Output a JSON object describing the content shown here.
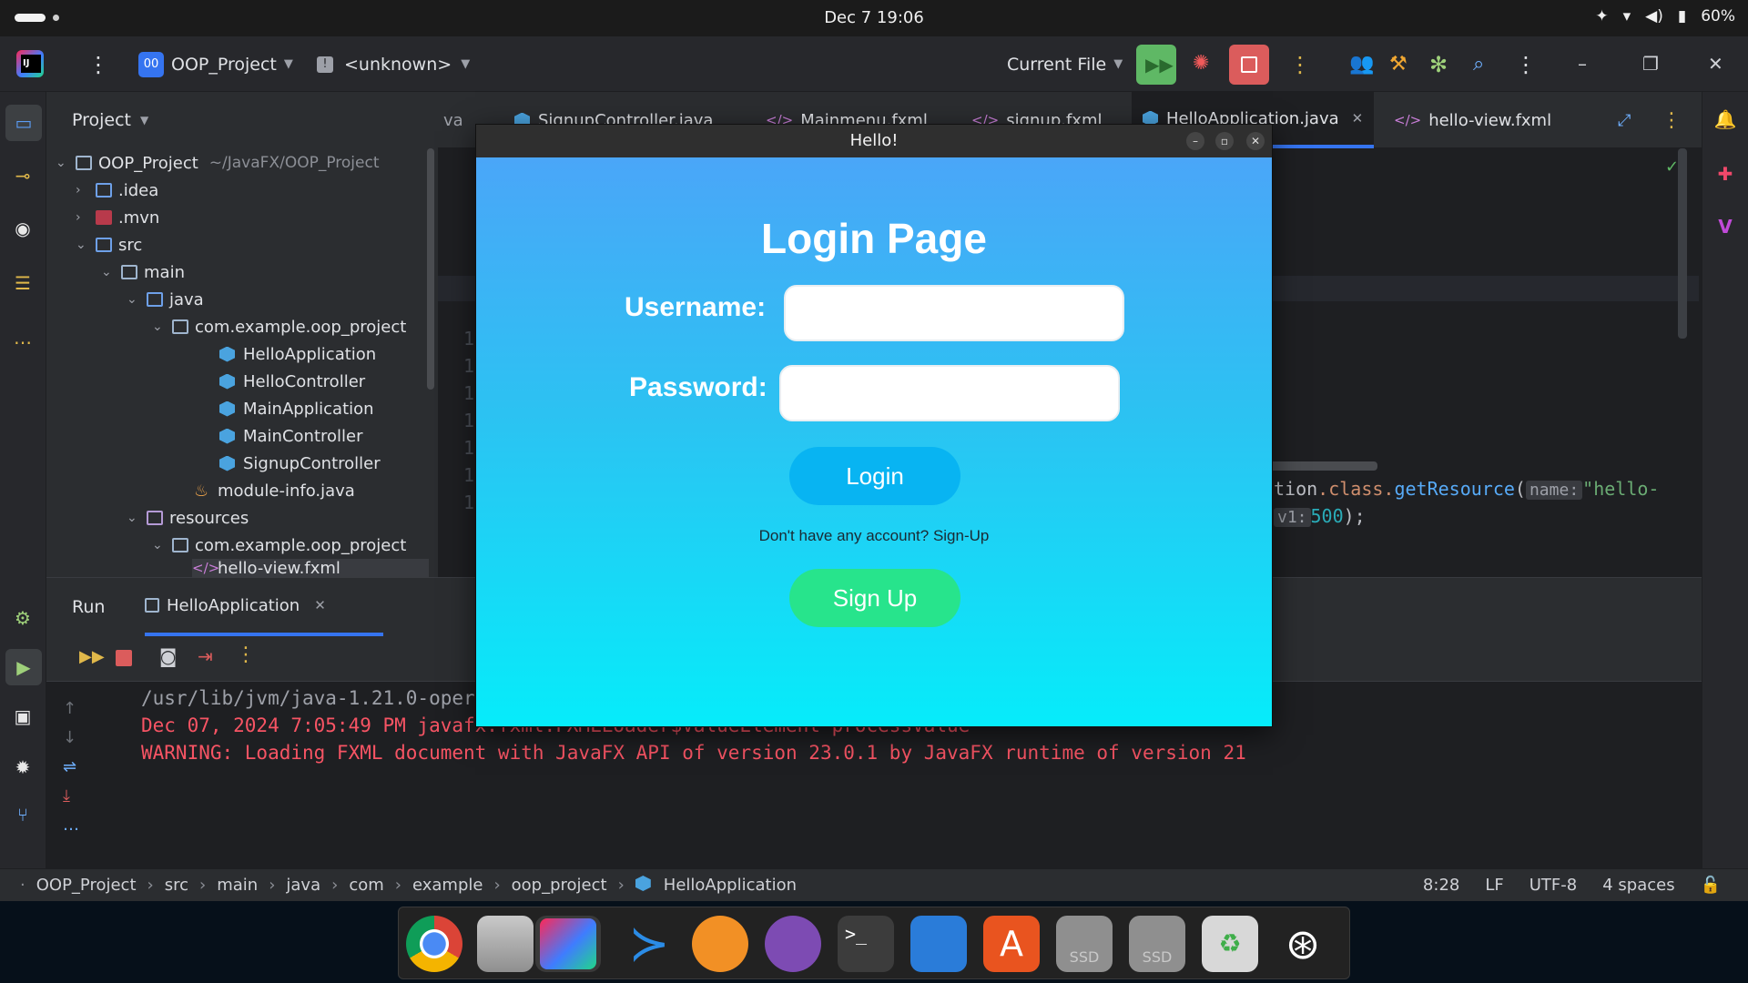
{
  "system_bar": {
    "datetime": "Dec 7  19:06",
    "battery": "60%"
  },
  "toolbar": {
    "project_badge": "00",
    "project_name": "OOP_Project",
    "branch": "<unknown>",
    "run_config": "Current File"
  },
  "project_panel": {
    "title": "Project",
    "tree": [
      {
        "label": "OOP_Project",
        "note": "~/JavaFX/OOP_Project"
      },
      {
        "label": ".idea"
      },
      {
        "label": ".mvn"
      },
      {
        "label": "src"
      },
      {
        "label": "main"
      },
      {
        "label": "java"
      },
      {
        "label": "com.example.oop_project"
      },
      {
        "label": "HelloApplication"
      },
      {
        "label": "HelloController"
      },
      {
        "label": "MainApplication"
      },
      {
        "label": "MainController"
      },
      {
        "label": "SignupController"
      },
      {
        "label": "module-info.java"
      },
      {
        "label": "resources"
      },
      {
        "label": "com.example.oop_project"
      },
      {
        "label": "hello-view.fxml"
      }
    ]
  },
  "editor": {
    "tabs": [
      {
        "label": "va"
      },
      {
        "label": "SignupController.java"
      },
      {
        "label": "Mainmenu.fxml"
      },
      {
        "label": "signup.fxml"
      },
      {
        "label": "HelloApplication.java"
      },
      {
        "label": "hello-view.fxml"
      }
    ],
    "code_line1": {
      "a": "tion",
      "b": ".class.",
      "c": "getResource",
      "d": "name:",
      "e": "\"hello-"
    },
    "code_line2": {
      "hint": "v1:",
      "value": "500",
      "tail": ");"
    },
    "gutter_digit": "1"
  },
  "run_panel": {
    "title": "Run",
    "tab_label": "HelloApplication",
    "console": [
      "/usr/lib/jvm/java-1.21.0-oper",
      "Dec 07, 2024 7:05:49 PM javafx.fxml.FXMLLoader$ValueElement processValue",
      "WARNING: Loading FXML document with JavaFX API of version 23.0.1 by JavaFX runtime of version 21"
    ]
  },
  "status_bar": {
    "breadcrumb": [
      "OOP_Project",
      "src",
      "main",
      "java",
      "com",
      "example",
      "oop_project",
      "HelloApplication"
    ],
    "position": "8:28",
    "line_sep": "LF",
    "encoding": "UTF-8",
    "indent": "4 spaces"
  },
  "hello_window": {
    "title": "Hello!",
    "heading": "Login Page",
    "username_label": "Username:",
    "password_label": "Password:",
    "login_button": "Login",
    "note": "Don't have any account? Sign-Up",
    "signup_button": "Sign Up"
  },
  "dock": {
    "ssd1": "SSD",
    "ssd2": "SSD"
  },
  "colors": {
    "accent": "#3574f0",
    "console_error": "#f75464",
    "login_gradient_top": "#4aa6f8",
    "login_gradient_bottom": "#06ecfa",
    "signup_green": "#27e48c"
  }
}
